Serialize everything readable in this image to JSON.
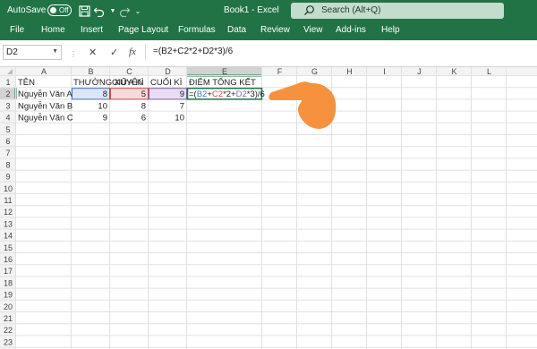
{
  "titlebar": {
    "autosave_label": "AutoSave",
    "autosave_state": "Off",
    "doc_title": "Book1 - Excel",
    "search_placeholder": "Search (Alt+Q)"
  },
  "menu": [
    {
      "label": "File"
    },
    {
      "label": "Home"
    },
    {
      "label": "Insert"
    },
    {
      "label": "Page Layout"
    },
    {
      "label": "Formulas"
    },
    {
      "label": "Data"
    },
    {
      "label": "Review"
    },
    {
      "label": "View"
    },
    {
      "label": "Add-ins"
    },
    {
      "label": "Help"
    }
  ],
  "formula_bar": {
    "name_box": "D2",
    "cancel_symbol": "✕",
    "enter_symbol": "✓",
    "fx_label": "fx",
    "formula": "=(B2+C2*2+D2*3)/6"
  },
  "sheet": {
    "columns": [
      "A",
      "B",
      "C",
      "D",
      "E",
      "F",
      "G",
      "H",
      "I",
      "J",
      "K",
      "L"
    ],
    "row_numbers": [
      "1",
      "2",
      "3",
      "4",
      "5",
      "6",
      "7",
      "8",
      "9",
      "10",
      "11",
      "12",
      "13",
      "14",
      "15",
      "16",
      "17",
      "18",
      "19",
      "20",
      "21",
      "22",
      "23"
    ],
    "active_row": "2",
    "active_column": "E",
    "cells": [
      {
        "ref": "A1",
        "text": "TÊN",
        "align": "left"
      },
      {
        "ref": "B1",
        "text": "THƯỜNG XUYÊN",
        "align": "left"
      },
      {
        "ref": "C1",
        "text": "GIỮA KÌ",
        "align": "left"
      },
      {
        "ref": "D1",
        "text": "CUỐI KÌ",
        "align": "left"
      },
      {
        "ref": "E1",
        "text": "ĐIỂM TỔNG KẾT",
        "align": "left"
      },
      {
        "ref": "A2",
        "text": "Nguyễn Văn A",
        "align": "left"
      },
      {
        "ref": "B2",
        "text": "8",
        "align": "right",
        "highlight": "#dbe5f6",
        "border": "#4472c4"
      },
      {
        "ref": "C2",
        "text": "5",
        "align": "right",
        "highlight": "#f8dada",
        "border": "#c0504d"
      },
      {
        "ref": "D2",
        "text": "9",
        "align": "right",
        "highlight": "#eadcf4",
        "border": "#8064a2"
      },
      {
        "ref": "A3",
        "text": "Nguyễn Văn B",
        "align": "left"
      },
      {
        "ref": "B3",
        "text": "10",
        "align": "right"
      },
      {
        "ref": "C3",
        "text": "8",
        "align": "right"
      },
      {
        "ref": "D3",
        "text": "7",
        "align": "right"
      },
      {
        "ref": "A4",
        "text": "Nguyễn Văn C",
        "align": "left"
      },
      {
        "ref": "B4",
        "text": "9",
        "align": "right"
      },
      {
        "ref": "C4",
        "text": "6",
        "align": "right"
      },
      {
        "ref": "D4",
        "text": "10",
        "align": "right"
      }
    ],
    "editing_cell": {
      "ref": "E2",
      "parts": [
        {
          "text": "=(",
          "color": "#222222"
        },
        {
          "text": "B2",
          "color": "#4472c4"
        },
        {
          "text": "+",
          "color": "#222222"
        },
        {
          "text": "C2",
          "color": "#c0504d"
        },
        {
          "text": "*2+",
          "color": "#222222"
        },
        {
          "text": "D2",
          "color": "#8064a2"
        },
        {
          "text": "*3)/6",
          "color": "#222222"
        }
      ]
    }
  },
  "colors": {
    "excel_green": "#217346",
    "hand": "#f6923e",
    "header_bg": "#f3f3f3",
    "active_header_bg": "#d2d2d2",
    "gridline": "#e1e1e1"
  },
  "icons": {
    "save": "save-icon",
    "undo": "undo-icon",
    "redo": "redo-icon",
    "customize": "customize-toolbar-icon",
    "search": "search-icon",
    "pointer": "pointing-hand-icon"
  }
}
